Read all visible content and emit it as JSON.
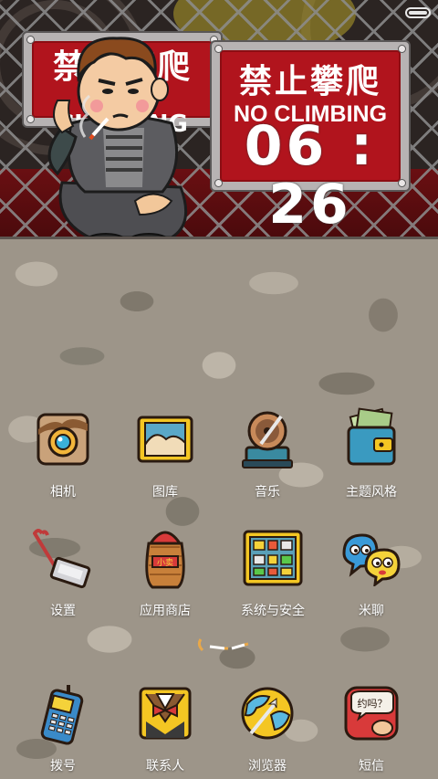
{
  "wallpaper": {
    "sign_left": {
      "chinese": "禁止攀爬",
      "english": "NO CLIMBING"
    },
    "sign_right": {
      "chinese": "禁止攀爬",
      "english": "NO CLIMBING"
    }
  },
  "clock": {
    "time": "06 : 26"
  },
  "status_bar": {
    "battery_icon": "battery-icon"
  },
  "apps_row1": [
    {
      "label": "相机",
      "icon": "camera-icon"
    },
    {
      "label": "图库",
      "icon": "gallery-icon"
    },
    {
      "label": "音乐",
      "icon": "music-icon"
    },
    {
      "label": "主题风格",
      "icon": "theme-icon"
    }
  ],
  "apps_row2": [
    {
      "label": "设置",
      "icon": "settings-icon"
    },
    {
      "label": "应用商店",
      "icon": "app-store-icon"
    },
    {
      "label": "系统与安全",
      "icon": "security-icon"
    },
    {
      "label": "米聊",
      "icon": "mitalk-icon"
    }
  ],
  "dock": [
    {
      "label": "拨号",
      "icon": "phone-icon"
    },
    {
      "label": "联系人",
      "icon": "contacts-icon"
    },
    {
      "label": "浏览器",
      "icon": "browser-icon"
    },
    {
      "label": "短信",
      "icon": "messages-icon"
    }
  ],
  "message_icon_text": "约吗？",
  "sign_plate_text": "小卖"
}
